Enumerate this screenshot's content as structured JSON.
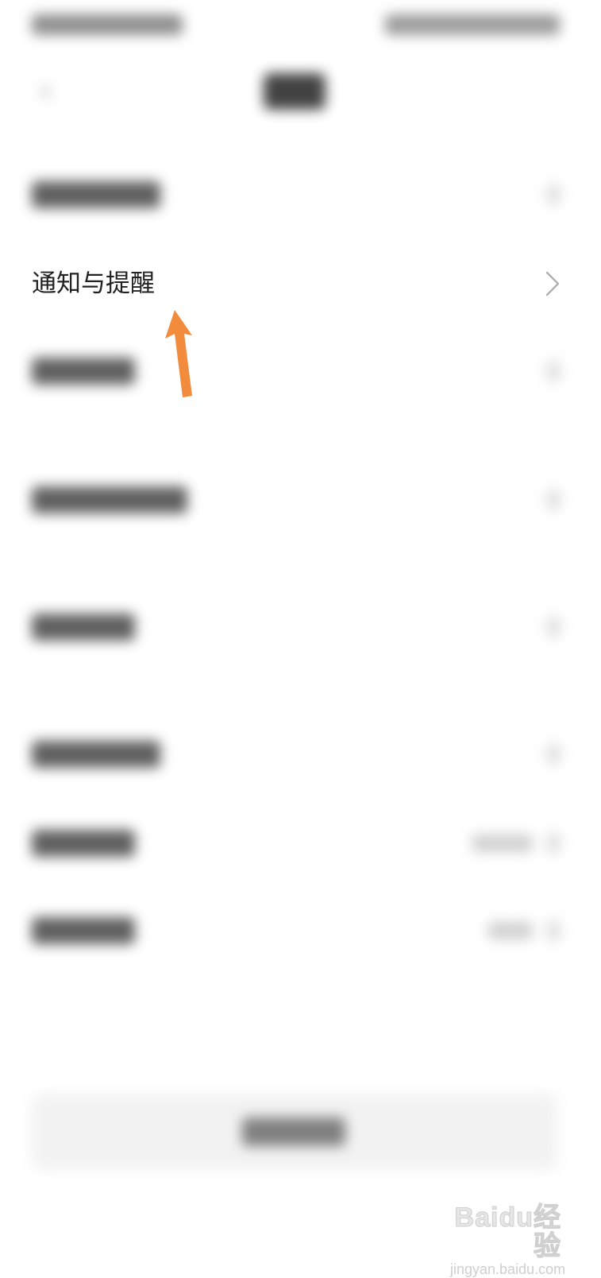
{
  "notifications_row": {
    "label": "通知与提醒"
  },
  "annotation": {
    "arrow_color": "#f28c3c"
  },
  "watermark": {
    "logo": "Baidu经验",
    "url": "jingyan.baidu.com"
  },
  "colors": {
    "background": "#ffffff",
    "text_primary": "#222222",
    "chevron": "#b0b0b0",
    "button_bg": "#f0f0f0"
  }
}
